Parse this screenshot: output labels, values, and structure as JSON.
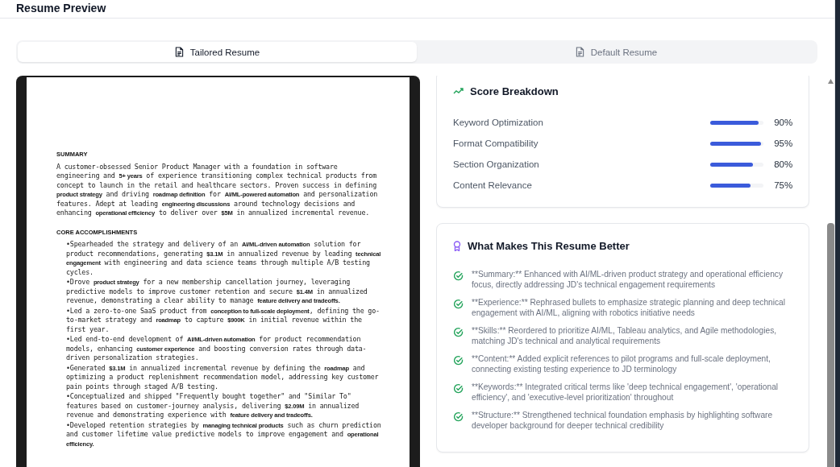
{
  "header": {
    "title": "Resume Preview"
  },
  "tabs": [
    {
      "label": "Tailored Resume",
      "selected": true
    },
    {
      "label": "Default Resume",
      "selected": false
    }
  ],
  "resume": {
    "sections": [
      {
        "heading": "SUMMARY",
        "paragraphs": [
          "A customer-obsessed Senior Product Manager with a foundation in software engineering and **5+ years** of experience transitioning complex technical products from concept to launch in the retail and healthcare sectors. Proven success in defining **product strategy** and driving **roadmap definition** for **AI/ML-powered automation** and personalization features. Adept at leading **engineering discussions** around technology decisions and enhancing **operational efficiency** to deliver over **$5M** in annualized incremental revenue."
        ]
      },
      {
        "heading": "CORE ACCOMPLISHMENTS",
        "bullets": [
          "•Spearheaded the strategy and delivery of an **AI/ML-driven automation** solution for product recommendations, generating **$3.1M** in annualized revenue by leading **technical engagement** with engineering and data science teams through multiple A/B testing cycles.",
          "•Drove **product strategy** for a new membership cancellation journey, leveraging predictive models to improve customer retention and secure **$1.4M** in annualized revenue, demonstrating a clear ability to manage **feature delivery and tradeoffs.**",
          "•Led a zero-to-one SaaS product from **conception to full-scale deployment**, defining the go-to-market strategy and **roadmap** to capture **$900K** in initial revenue within the first year.",
          "•Led end-to-end development of **AI/ML-driven automation** for product recommendation models, enhancing **customer experience** and boosting conversion rates through data-driven personalization strategies.",
          "•Generated **$3.1M** in annualized incremental revenue by defining the **roadmap** and optimizing a product replenishment recommendation model, addressing key customer pain points through staged A/B testing.",
          "•Conceptualized and shipped \"Frequently bought together\" and \"Similar To\" features based on customer-journey analysis, delivering **$2.09M** in annualized revenue and demonstrating experience with **feature delivery and tradeoffs.**",
          "•Developed retention strategies by **managing technical products** such as churn prediction and customer lifetime value predictive models to improve engagement and **operational efficiency.**"
        ]
      }
    ]
  },
  "score": {
    "title": "Score Breakdown",
    "rows": [
      {
        "label": "Keyword Optimization",
        "level": 0.9,
        "reading": "90%"
      },
      {
        "label": "Format Compatibility",
        "level": 0.95,
        "reading": "95%"
      },
      {
        "label": "Section Organization",
        "level": 0.8,
        "reading": "80%"
      },
      {
        "label": "Content Relevance",
        "level": 0.75,
        "reading": "75%"
      }
    ]
  },
  "improvements": {
    "title": "What Makes This Resume Better",
    "items": [
      "**Summary:** Enhanced with AI/ML-driven product strategy and operational efficiency focus, directly addressing JD's technical engagement requirements",
      "**Experience:** Rephrased bullets to emphasize strategic planning and deep technical engagement with AI/ML, aligning with robotics initiative needs",
      "**Skills:** Reordered to prioritize AI/ML, Tableau analytics, and Agile methodologies, matching JD's technical and analytical requirements",
      "**Content:** Added explicit references to pilot programs and full-scale deployment, connecting existing testing experience to JD terminology",
      "**Keywords:** Integrated critical terms like 'deep technical engagement', 'operational efficiency', and 'executive-level prioritization' throughout",
      "**Structure:** Strengthened technical foundation emphasis by highlighting software developer background for deeper technical credibility"
    ]
  }
}
